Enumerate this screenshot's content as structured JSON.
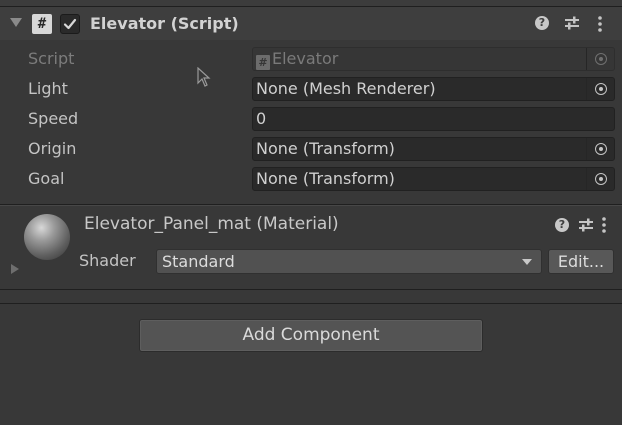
{
  "script_component": {
    "title": "Elevator (Script)",
    "enabled": true,
    "icons": {
      "foldout": "foldout-arrow-expanded",
      "script": "script-hash-icon",
      "help": "help-icon",
      "presets": "presets-sliders-icon",
      "menu": "kebab-menu-icon"
    },
    "properties": [
      {
        "label": "Script",
        "value": "Elevator",
        "disabled": true,
        "type": "object-field"
      },
      {
        "label": "Light",
        "value": "None (Mesh Renderer)",
        "disabled": false,
        "type": "object-field"
      },
      {
        "label": "Speed",
        "value": "0",
        "disabled": false,
        "type": "number-field"
      },
      {
        "label": "Origin",
        "value": "None (Transform)",
        "disabled": false,
        "type": "object-field"
      },
      {
        "label": "Goal",
        "value": "None (Transform)",
        "disabled": false,
        "type": "object-field"
      }
    ]
  },
  "material_component": {
    "title": "Elevator_Panel_mat (Material)",
    "shader_label": "Shader",
    "shader_value": "Standard",
    "edit_label": "Edit..."
  },
  "add_component_label": "Add Component",
  "colors": {
    "background": "#383838",
    "field_bg": "#2a2a2a",
    "text": "#c4c4c4",
    "button_bg": "#545454"
  }
}
